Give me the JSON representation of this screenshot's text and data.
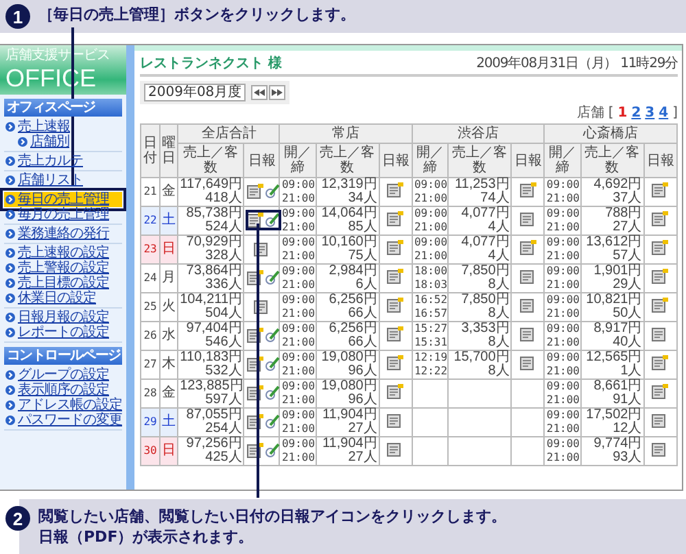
{
  "callouts": [
    {
      "number": "1",
      "lines": [
        "［毎日の売上管理］ボタンをクリックします。"
      ]
    },
    {
      "number": "2",
      "lines": [
        "閲覧したい店舗、閲覧したい日付の日報アイコンをクリックします。",
        "日報（PDF）が表示されます。"
      ]
    }
  ],
  "sidebar": {
    "brand": "店舗支援サービス",
    "logo": "OFFICE",
    "groups": [
      {
        "title": "オフィスページ",
        "sections": [
          [
            {
              "label": "売上速報",
              "selected": false,
              "children": [
                {
                  "label": "店舗別",
                  "selected": false
                }
              ]
            }
          ],
          [
            {
              "label": "売上カルテ",
              "selected": false
            }
          ],
          [
            {
              "label": "店舗リスト",
              "selected": false
            }
          ],
          [
            {
              "label": "毎日の売上管理",
              "selected": true
            },
            {
              "label": "毎月の売上管理",
              "selected": false
            }
          ],
          [
            {
              "label": "業務連絡の発行",
              "selected": false
            }
          ],
          [
            {
              "label": "売上速報の設定",
              "selected": false
            },
            {
              "label": "売上警報の設定",
              "selected": false
            },
            {
              "label": "売上目標の設定",
              "selected": false
            },
            {
              "label": "休業日の設定",
              "selected": false
            }
          ],
          [
            {
              "label": "日報月報の設定",
              "selected": false
            },
            {
              "label": "レポートの設定",
              "selected": false
            }
          ]
        ]
      },
      {
        "title": "コントロールページ",
        "sections": [
          [
            {
              "label": "グループの設定",
              "selected": false
            },
            {
              "label": "表示順序の設定",
              "selected": false
            },
            {
              "label": "アドレス帳の設定",
              "selected": false
            },
            {
              "label": "パスワードの変更",
              "selected": false
            }
          ]
        ]
      }
    ]
  },
  "header": {
    "customer": "レストランネクスト 様",
    "datetime": "2009年08月31日（月） 11時29分"
  },
  "toolbar": {
    "month": "2009年08月度"
  },
  "store_pager": {
    "label": "店舗",
    "open": "[",
    "close": "]",
    "pages": [
      {
        "label": "1",
        "selected": true
      },
      {
        "label": "2",
        "selected": false
      },
      {
        "label": "3",
        "selected": false
      },
      {
        "label": "4",
        "selected": false
      }
    ]
  },
  "table": {
    "date_header": "日付",
    "weekday_header": "曜日",
    "groups": [
      {
        "name": "全店合計",
        "columns": [
          "売上／客数",
          "日報"
        ]
      },
      {
        "name": "常店",
        "columns": [
          "開／締",
          "売上／客数",
          "日報"
        ]
      },
      {
        "name": "渋谷店",
        "columns": [
          "開／締",
          "売上／客数",
          "日報"
        ]
      },
      {
        "name": "心斎橋店",
        "columns": [
          "開／締",
          "売上／客数",
          "日報"
        ]
      }
    ],
    "rows": [
      {
        "date": "21",
        "weekday": "金",
        "kind": "weekday",
        "total": {
          "sales": "117,649円",
          "guests": "418人",
          "has_edit": true,
          "highlighted": false
        },
        "stores": [
          {
            "open": "09:00",
            "close": "21:00",
            "sales": "12,319円",
            "guests": "34人",
            "report_new": true
          },
          {
            "open": "09:00",
            "close": "21:00",
            "sales": "11,253円",
            "guests": "74人",
            "report_new": true
          },
          {
            "open": "09:00",
            "close": "21:00",
            "sales": "4,692円",
            "guests": "37人",
            "report_new": true
          }
        ]
      },
      {
        "date": "22",
        "weekday": "土",
        "kind": "saturday",
        "total": {
          "sales": "85,738円",
          "guests": "524人",
          "has_edit": true,
          "highlighted": true
        },
        "stores": [
          {
            "open": "09:00",
            "close": "21:00",
            "sales": "14,064円",
            "guests": "85人",
            "report_new": true
          },
          {
            "open": "09:00",
            "close": "21:00",
            "sales": "4,077円",
            "guests": "4人",
            "report_new": false
          },
          {
            "open": "09:00",
            "close": "21:00",
            "sales": "788円",
            "guests": "27人",
            "report_new": true
          }
        ]
      },
      {
        "date": "23",
        "weekday": "日",
        "kind": "sunday",
        "total": {
          "sales": "70,929円",
          "guests": "328人",
          "has_edit": false,
          "highlighted": false
        },
        "stores": [
          {
            "open": "09:00",
            "close": "21:00",
            "sales": "10,160円",
            "guests": "75人",
            "report_new": true
          },
          {
            "open": "09:00",
            "close": "21:00",
            "sales": "4,077円",
            "guests": "4人",
            "report_new": true
          },
          {
            "open": "09:00",
            "close": "21:00",
            "sales": "13,612円",
            "guests": "57人",
            "report_new": true
          }
        ]
      },
      {
        "date": "24",
        "weekday": "月",
        "kind": "weekday",
        "total": {
          "sales": "73,864円",
          "guests": "336人",
          "has_edit": true,
          "highlighted": false
        },
        "stores": [
          {
            "open": "09:00",
            "close": "21:00",
            "sales": "2,984円",
            "guests": "6人",
            "report_new": true
          },
          {
            "open": "18:00",
            "close": "18:03",
            "sales": "7,850円",
            "guests": "8人",
            "report_new": false
          },
          {
            "open": "09:00",
            "close": "21:00",
            "sales": "1,901円",
            "guests": "29人",
            "report_new": true
          }
        ]
      },
      {
        "date": "25",
        "weekday": "火",
        "kind": "weekday",
        "total": {
          "sales": "104,211円",
          "guests": "504人",
          "has_edit": false,
          "highlighted": false
        },
        "stores": [
          {
            "open": "09:00",
            "close": "21:00",
            "sales": "6,256円",
            "guests": "66人",
            "report_new": true
          },
          {
            "open": "16:52",
            "close": "16:57",
            "sales": "7,850円",
            "guests": "8人",
            "report_new": false
          },
          {
            "open": "09:00",
            "close": "21:00",
            "sales": "10,821円",
            "guests": "50人",
            "report_new": true
          }
        ]
      },
      {
        "date": "26",
        "weekday": "水",
        "kind": "weekday",
        "total": {
          "sales": "97,404円",
          "guests": "546人",
          "has_edit": true,
          "highlighted": false
        },
        "stores": [
          {
            "open": "09:00",
            "close": "21:00",
            "sales": "6,256円",
            "guests": "66人",
            "report_new": true
          },
          {
            "open": "15:27",
            "close": "15:31",
            "sales": "3,353円",
            "guests": "8人",
            "report_new": false
          },
          {
            "open": "09:00",
            "close": "21:00",
            "sales": "8,917円",
            "guests": "40人",
            "report_new": false
          }
        ]
      },
      {
        "date": "27",
        "weekday": "木",
        "kind": "weekday",
        "total": {
          "sales": "110,183円",
          "guests": "532人",
          "has_edit": true,
          "highlighted": false
        },
        "stores": [
          {
            "open": "09:00",
            "close": "21:00",
            "sales": "19,080円",
            "guests": "96人",
            "report_new": true
          },
          {
            "open": "12:19",
            "close": "12:22",
            "sales": "15,700円",
            "guests": "8人",
            "report_new": false
          },
          {
            "open": "09:00",
            "close": "21:00",
            "sales": "12,565円",
            "guests": "1人",
            "report_new": true
          }
        ]
      },
      {
        "date": "28",
        "weekday": "金",
        "kind": "weekday",
        "total": {
          "sales": "123,885円",
          "guests": "597人",
          "has_edit": true,
          "highlighted": false
        },
        "stores": [
          {
            "open": "09:00",
            "close": "21:00",
            "sales": "19,080円",
            "guests": "96人",
            "report_new": true
          },
          {
            "kind": "empty"
          },
          {
            "open": "09:00",
            "close": "21:00",
            "sales": "8,661円",
            "guests": "91人",
            "report_new": true
          }
        ]
      },
      {
        "date": "29",
        "weekday": "土",
        "kind": "saturday",
        "total": {
          "sales": "87,055円",
          "guests": "254人",
          "has_edit": true,
          "highlighted": false
        },
        "stores": [
          {
            "open": "09:00",
            "close": "21:00",
            "sales": "11,904円",
            "guests": "27人",
            "report_new": false
          },
          {
            "kind": "empty"
          },
          {
            "open": "09:00",
            "close": "21:00",
            "sales": "17,502円",
            "guests": "12人",
            "report_new": false
          }
        ]
      },
      {
        "date": "30",
        "weekday": "日",
        "kind": "sunday",
        "total": {
          "sales": "97,256円",
          "guests": "425人",
          "has_edit": true,
          "highlighted": false
        },
        "stores": [
          {
            "open": "09:00",
            "close": "21:00",
            "sales": "11,904円",
            "guests": "27人",
            "report_new": false
          },
          {
            "kind": "empty"
          },
          {
            "open": "09:00",
            "close": "21:00",
            "sales": "9,774円",
            "guests": "93人",
            "report_new": false
          }
        ]
      }
    ]
  }
}
